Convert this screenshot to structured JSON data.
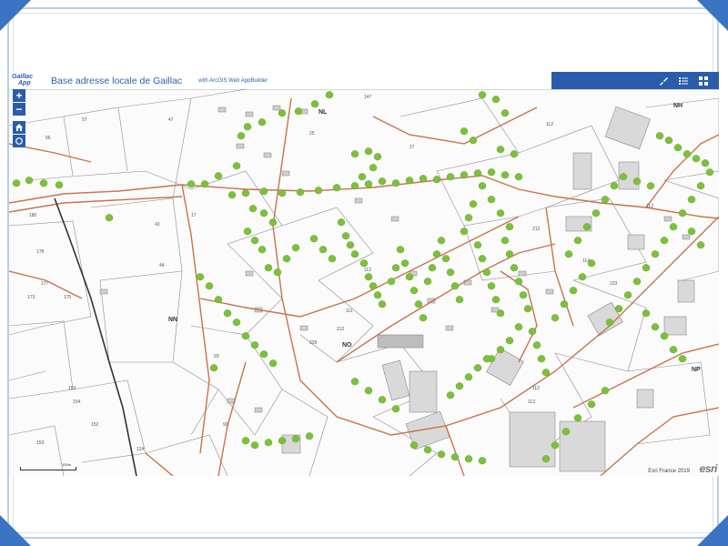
{
  "header": {
    "logo_line1": "Gaillac",
    "logo_line2": "App",
    "title": "Base adresse locale de Gaillac",
    "subtitle": "with ArcGIS Web AppBuilder"
  },
  "toolbar": {
    "items": [
      {
        "name": "layers-tool",
        "icon": "brush-icon"
      },
      {
        "name": "legend-tool",
        "icon": "list-icon"
      },
      {
        "name": "basemap-tool",
        "icon": "grid-icon"
      }
    ]
  },
  "zoom": {
    "in_label": "+",
    "out_label": "−"
  },
  "map": {
    "sectors": [
      {
        "label": "NN"
      },
      {
        "label": "NO"
      },
      {
        "label": "NL"
      },
      {
        "label": "NH"
      },
      {
        "label": "NP"
      }
    ],
    "attribution": "Esri France 2019",
    "provider": "esri",
    "scale_label": "100m",
    "marker_color": "#7cc03c",
    "road_color": "#c9734a"
  }
}
